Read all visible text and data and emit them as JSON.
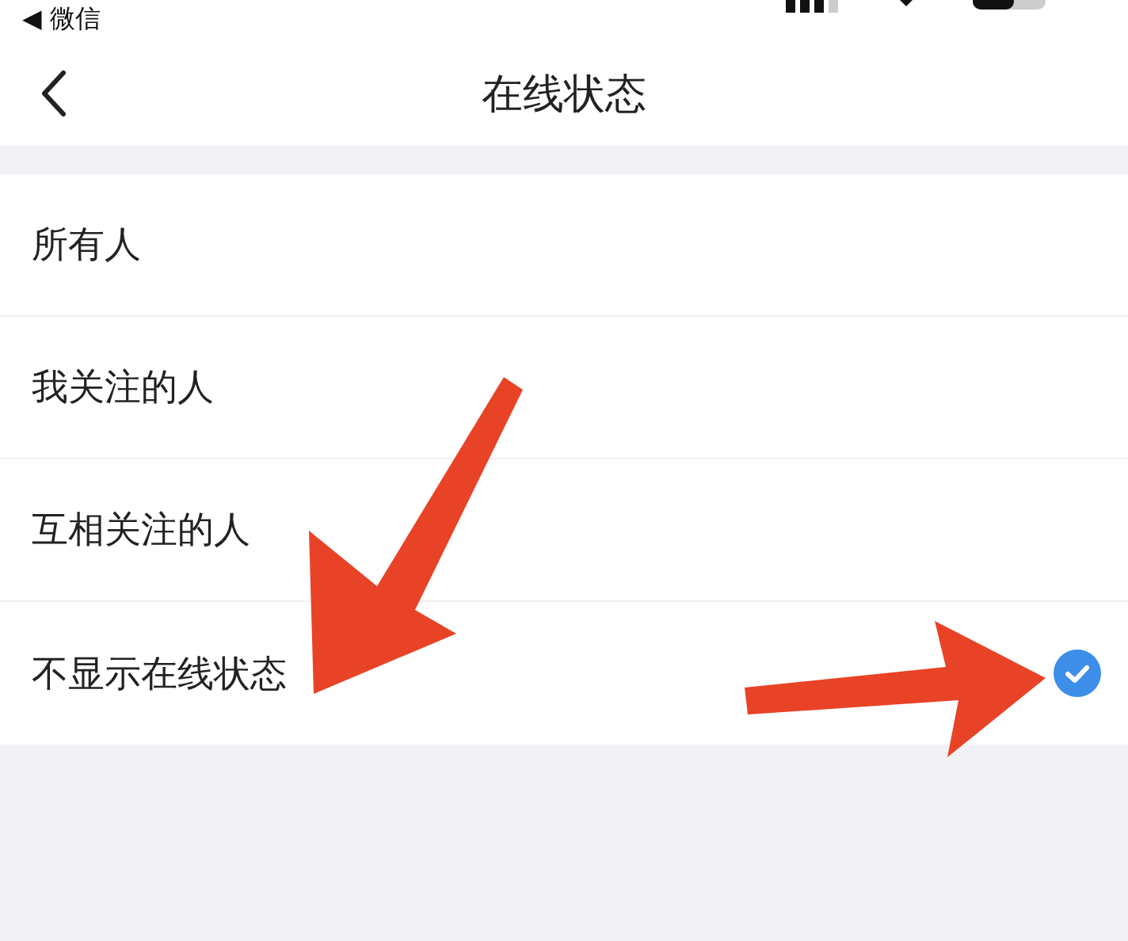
{
  "status_bar": {
    "back_app": "◀ 微信"
  },
  "nav": {
    "title": "在线状态"
  },
  "options": [
    {
      "label": "所有人",
      "selected": false
    },
    {
      "label": "我关注的人",
      "selected": false
    },
    {
      "label": "互相关注的人",
      "selected": false
    },
    {
      "label": "不显示在线状态",
      "selected": true
    }
  ]
}
